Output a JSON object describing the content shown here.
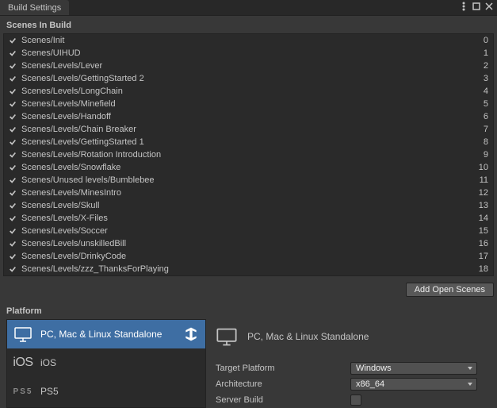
{
  "window": {
    "title": "Build Settings"
  },
  "scenes": {
    "header": "Scenes In Build",
    "items": [
      {
        "checked": true,
        "path": "Scenes/Init",
        "index": "0"
      },
      {
        "checked": true,
        "path": "Scenes/UIHUD",
        "index": "1"
      },
      {
        "checked": true,
        "path": "Scenes/Levels/Lever",
        "index": "2"
      },
      {
        "checked": true,
        "path": "Scenes/Levels/GettingStarted 2",
        "index": "3"
      },
      {
        "checked": true,
        "path": "Scenes/Levels/LongChain",
        "index": "4"
      },
      {
        "checked": true,
        "path": "Scenes/Levels/Minefield",
        "index": "5"
      },
      {
        "checked": true,
        "path": "Scenes/Levels/Handoff",
        "index": "6"
      },
      {
        "checked": true,
        "path": "Scenes/Levels/Chain Breaker",
        "index": "7"
      },
      {
        "checked": true,
        "path": "Scenes/Levels/GettingStarted 1",
        "index": "8"
      },
      {
        "checked": true,
        "path": "Scenes/Levels/Rotation Introduction",
        "index": "9"
      },
      {
        "checked": true,
        "path": "Scenes/Levels/Snowflake",
        "index": "10"
      },
      {
        "checked": true,
        "path": "Scenes/Unused levels/Bumblebee",
        "index": "11"
      },
      {
        "checked": true,
        "path": "Scenes/Levels/MinesIntro",
        "index": "12"
      },
      {
        "checked": true,
        "path": "Scenes/Levels/Skull",
        "index": "13"
      },
      {
        "checked": true,
        "path": "Scenes/Levels/X-Files",
        "index": "14"
      },
      {
        "checked": true,
        "path": "Scenes/Levels/Soccer",
        "index": "15"
      },
      {
        "checked": true,
        "path": "Scenes/Levels/unskilledBill",
        "index": "16"
      },
      {
        "checked": true,
        "path": "Scenes/Levels/DrinkyCode",
        "index": "17"
      },
      {
        "checked": true,
        "path": "Scenes/Levels/zzz_ThanksForPlaying",
        "index": "18"
      }
    ],
    "addButton": "Add Open Scenes"
  },
  "platform": {
    "header": "Platform",
    "items": [
      {
        "name": "PC, Mac & Linux Standalone",
        "icon": "monitor",
        "selected": true,
        "showUnity": true
      },
      {
        "name": "iOS",
        "icon": "ios",
        "selected": false
      },
      {
        "name": "PS5",
        "icon": "ps5",
        "selected": false
      }
    ]
  },
  "details": {
    "title": "PC, Mac & Linux Standalone",
    "targetPlatform": {
      "label": "Target Platform",
      "value": "Windows"
    },
    "architecture": {
      "label": "Architecture",
      "value": "x86_64"
    },
    "serverBuild": {
      "label": "Server Build",
      "checked": false
    }
  }
}
